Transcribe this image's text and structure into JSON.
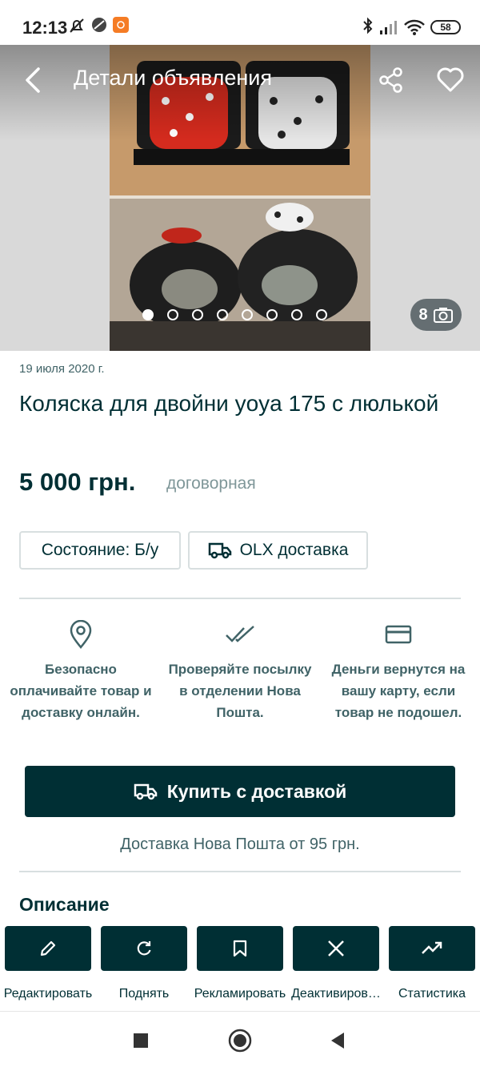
{
  "status_bar": {
    "time": "12:13",
    "battery": "58",
    "icons": [
      "mute-icon",
      "dnd-icon",
      "app-notification-icon",
      "bluetooth-icon",
      "signal-icon",
      "wifi-icon",
      "battery-icon"
    ]
  },
  "header": {
    "title": "Детали объявления",
    "back_icon": "back-arrow-icon",
    "share_icon": "share-icon",
    "favorite_icon": "heart-icon"
  },
  "gallery": {
    "photo_count": "8",
    "dots_total": 8,
    "active_dot": 1
  },
  "listing": {
    "date": "19 июля 2020 г.",
    "title": "Коляска для двойни yoya 175 с люлькой",
    "price": "5 000 грн.",
    "price_note": "договорная"
  },
  "chips": [
    {
      "label": "Состояние: Б/у"
    },
    {
      "label": "OLX доставка",
      "icon": "truck-icon"
    }
  ],
  "features": [
    {
      "icon": "location-pin-icon",
      "text": "Безопасно оплачивайте товар и доставку онлайн."
    },
    {
      "icon": "double-check-icon",
      "text": "Проверяйте посылку в отделении Нова Пошта."
    },
    {
      "icon": "credit-card-icon",
      "text": "Деньги вернутся на вашу карту, если товар не подошел."
    }
  ],
  "buy_button": {
    "label": "Купить с доставкой",
    "icon": "truck-icon"
  },
  "delivery_note": "Доставка Нова Пошта от 95 грн.",
  "description_title": "Описание",
  "actions": [
    {
      "icon": "pencil-icon",
      "label": "Редактировать"
    },
    {
      "icon": "refresh-icon",
      "label": "Поднять"
    },
    {
      "icon": "bookmark-icon",
      "label": "Рекламировать"
    },
    {
      "icon": "close-icon",
      "label": "Деактивиров…"
    },
    {
      "icon": "trending-up-icon",
      "label": "Статистика"
    }
  ],
  "colors": {
    "primary": "#002f34",
    "secondary_text": "#406367",
    "muted_text": "#7f9799",
    "border": "#d8dfe0"
  }
}
